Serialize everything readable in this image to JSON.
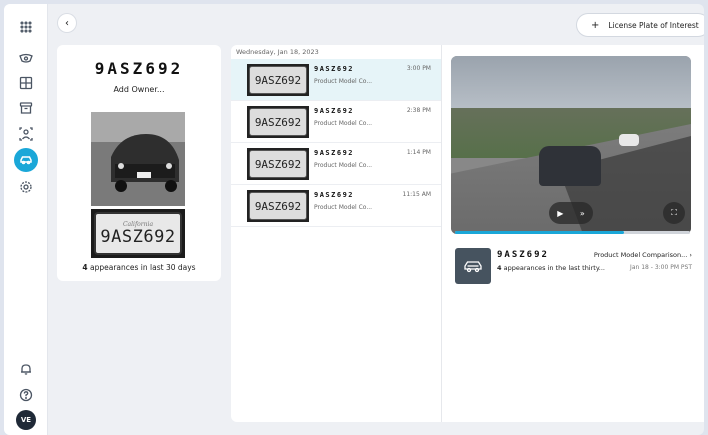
{
  "header": {
    "back_icon": "chevron-left-icon",
    "lpi_plus": "+",
    "lpi_label": "License Plate of Interest"
  },
  "rail": {
    "items": [
      "grid-icon",
      "camera-icon",
      "layout-icon",
      "archive-icon",
      "person-search-icon",
      "vehicle-icon",
      "gear-icon"
    ],
    "active": "vehicle-icon",
    "bottom": [
      "bell-icon",
      "help-icon"
    ],
    "avatar": "VE",
    "accent": "#1aa7d8"
  },
  "plate_card": {
    "plate": "9ASZ692",
    "add_owner": "Add Owner...",
    "plate_state": "California",
    "plate_number": "9ASZ692",
    "count": "4",
    "appearances_text": "appearances in last 30 days"
  },
  "timeline": {
    "date": "Wednesday, Jan 18, 2023",
    "rows": [
      {
        "plate": "9ASZ692",
        "model": "Product Model Co...",
        "time": "3:00 PM"
      },
      {
        "plate": "9ASZ692",
        "model": "Product Model Co...",
        "time": "2:38 PM"
      },
      {
        "plate": "9ASZ692",
        "model": "Product Model Co...",
        "time": "1:14 PM"
      },
      {
        "plate": "9ASZ692",
        "model": "Product Model Co...",
        "time": "11:15 AM"
      }
    ],
    "thumb_text": [
      "9ASZ692",
      "9ASZ692",
      "9ASZ692",
      "9ASZ692"
    ]
  },
  "detail": {
    "play_icon": "▶",
    "forward_icon": "»",
    "fullscreen_icon": "⛶",
    "progress": 0.72,
    "plate": "9ASZ692",
    "count": "4",
    "appearances_text": "appearances in the last thirty...",
    "link": "Product Model Comparison...",
    "chevron": "›",
    "time": "Jan 18 - 3:00 PM PST"
  }
}
